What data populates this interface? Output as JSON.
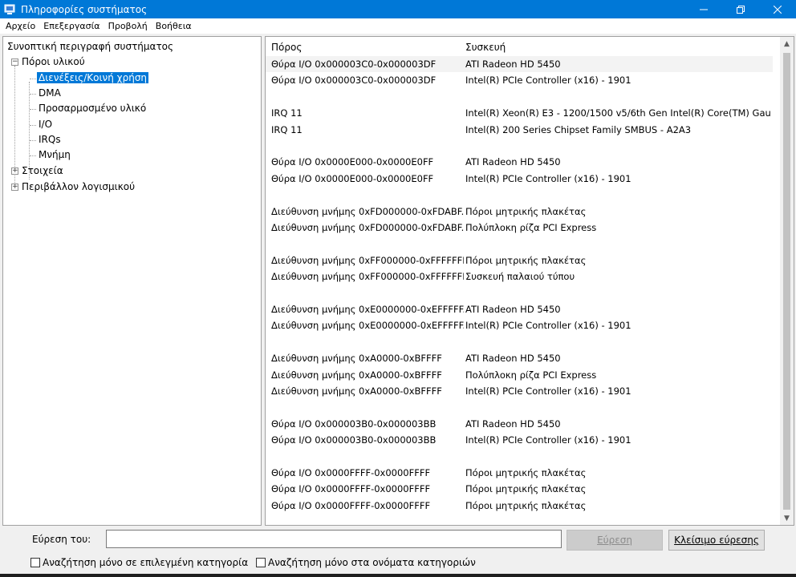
{
  "window": {
    "title": "Πληροφορίες συστήματος"
  },
  "menu": [
    "Αρχείο",
    "Επεξεργασία",
    "Προβολή",
    "Βοήθεια"
  ],
  "tree": {
    "root": "Συνοπτική περιγραφή συστήματος",
    "hardware": "Πόροι υλικού",
    "hardware_children": [
      "Διενέξεις/Κοινή χρήση",
      "DMA",
      "Προσαρμοσμένο υλικό",
      "I/O",
      "IRQs",
      "Μνήμη"
    ],
    "components": "Στοιχεία",
    "software": "Περιβάλλον λογισμικού",
    "expanded_glyph": "−",
    "collapsed_glyph": "+"
  },
  "list": {
    "col_resource": "Πόρος",
    "col_device": "Συσκευή",
    "rows": [
      {
        "resource": "Θύρα I/O 0x000003C0-0x000003DF",
        "device": "ATI Radeon HD 5450"
      },
      {
        "resource": "Θύρα I/O 0x000003C0-0x000003DF",
        "device": "Intel(R) PCIe Controller (x16) - 1901"
      },
      {
        "resource": "",
        "device": ""
      },
      {
        "resource": "IRQ 11",
        "device": "Intel(R) Xeon(R) E3 - 1200/1500 v5/6th Gen Intel(R) Core(TM) Gau..."
      },
      {
        "resource": "IRQ 11",
        "device": "Intel(R) 200 Series Chipset Family SMBUS - A2A3"
      },
      {
        "resource": "",
        "device": ""
      },
      {
        "resource": "Θύρα I/O 0x0000E000-0x0000E0FF",
        "device": "ATI Radeon HD 5450"
      },
      {
        "resource": "Θύρα I/O 0x0000E000-0x0000E0FF",
        "device": "Intel(R) PCIe Controller (x16) - 1901"
      },
      {
        "resource": "",
        "device": ""
      },
      {
        "resource": "Διεύθυνση μνήμης 0xFD000000-0xFDABF...",
        "device": "Πόροι μητρικής πλακέτας"
      },
      {
        "resource": "Διεύθυνση μνήμης 0xFD000000-0xFDABF...",
        "device": "Πολύπλοκη ρίζα PCI Express"
      },
      {
        "resource": "",
        "device": ""
      },
      {
        "resource": "Διεύθυνση μνήμης 0xFF000000-0xFFFFFFFF",
        "device": "Πόροι μητρικής πλακέτας"
      },
      {
        "resource": "Διεύθυνση μνήμης 0xFF000000-0xFFFFFFFF",
        "device": "Συσκευή παλαιού τύπου"
      },
      {
        "resource": "",
        "device": ""
      },
      {
        "resource": "Διεύθυνση μνήμης 0xE0000000-0xEFFFFF...",
        "device": "ATI Radeon HD 5450"
      },
      {
        "resource": "Διεύθυνση μνήμης 0xE0000000-0xEFFFFF...",
        "device": "Intel(R) PCIe Controller (x16) - 1901"
      },
      {
        "resource": "",
        "device": ""
      },
      {
        "resource": "Διεύθυνση μνήμης 0xA0000-0xBFFFF",
        "device": "ATI Radeon HD 5450"
      },
      {
        "resource": "Διεύθυνση μνήμης 0xA0000-0xBFFFF",
        "device": "Πολύπλοκη ρίζα PCI Express"
      },
      {
        "resource": "Διεύθυνση μνήμης 0xA0000-0xBFFFF",
        "device": "Intel(R) PCIe Controller (x16) - 1901"
      },
      {
        "resource": "",
        "device": ""
      },
      {
        "resource": "Θύρα I/O 0x000003B0-0x000003BB",
        "device": "ATI Radeon HD 5450"
      },
      {
        "resource": "Θύρα I/O 0x000003B0-0x000003BB",
        "device": "Intel(R) PCIe Controller (x16) - 1901"
      },
      {
        "resource": "",
        "device": ""
      },
      {
        "resource": "Θύρα I/O 0x0000FFFF-0x0000FFFF",
        "device": "Πόροι μητρικής πλακέτας"
      },
      {
        "resource": "Θύρα I/O 0x0000FFFF-0x0000FFFF",
        "device": "Πόροι μητρικής πλακέτας"
      },
      {
        "resource": "Θύρα I/O 0x0000FFFF-0x0000FFFF",
        "device": "Πόροι μητρικής πλακέτας"
      }
    ]
  },
  "find": {
    "label": "Εύρεση του:",
    "value": "",
    "find_button": "Εύρεση",
    "close_button": "Κλείσιμο εύρεσης",
    "check_selected": "Αναζήτηση μόνο σε επιλεγμένη κατηγορία",
    "check_names": "Αναζήτηση μόνο στα ονόματα κατηγοριών"
  }
}
